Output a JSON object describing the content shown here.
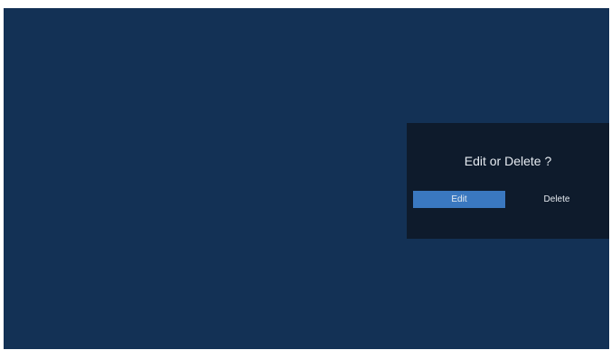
{
  "dialog": {
    "title": "Edit or Delete ?",
    "buttons": {
      "edit_label": "Edit",
      "delete_label": "Delete"
    },
    "focused_button": "edit"
  },
  "colors": {
    "background": "#133155",
    "dialog_background": "#0e1b2c",
    "focus_highlight": "#3a78c0",
    "text": "#e6ebf1"
  }
}
